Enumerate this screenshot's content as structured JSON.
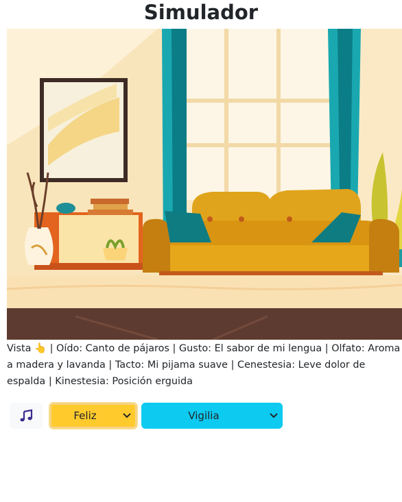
{
  "header": {
    "title": "Simulador"
  },
  "scene": {
    "description_icon": "living-room-illustration"
  },
  "senses": {
    "vista": "Vista",
    "vista_icon": "👆",
    "sep": " | ",
    "oido": "Oído: Canto de pájaros",
    "gusto": "Gusto: El sabor de mi lengua",
    "olfato": "Olfato: Aroma a madera y lavanda",
    "tacto": "Tacto: Mi pijama suave",
    "cenestesia": "Cenestesia: Leve dolor de espalda",
    "kinestesia": "Kinestesia: Posición erguida"
  },
  "controls": {
    "music_icon": "music-note-icon",
    "mood_select": {
      "value": "Feliz",
      "color": "#ffca2c"
    },
    "state_select": {
      "value": "Vigilia",
      "color": "#0dcaf0"
    }
  }
}
